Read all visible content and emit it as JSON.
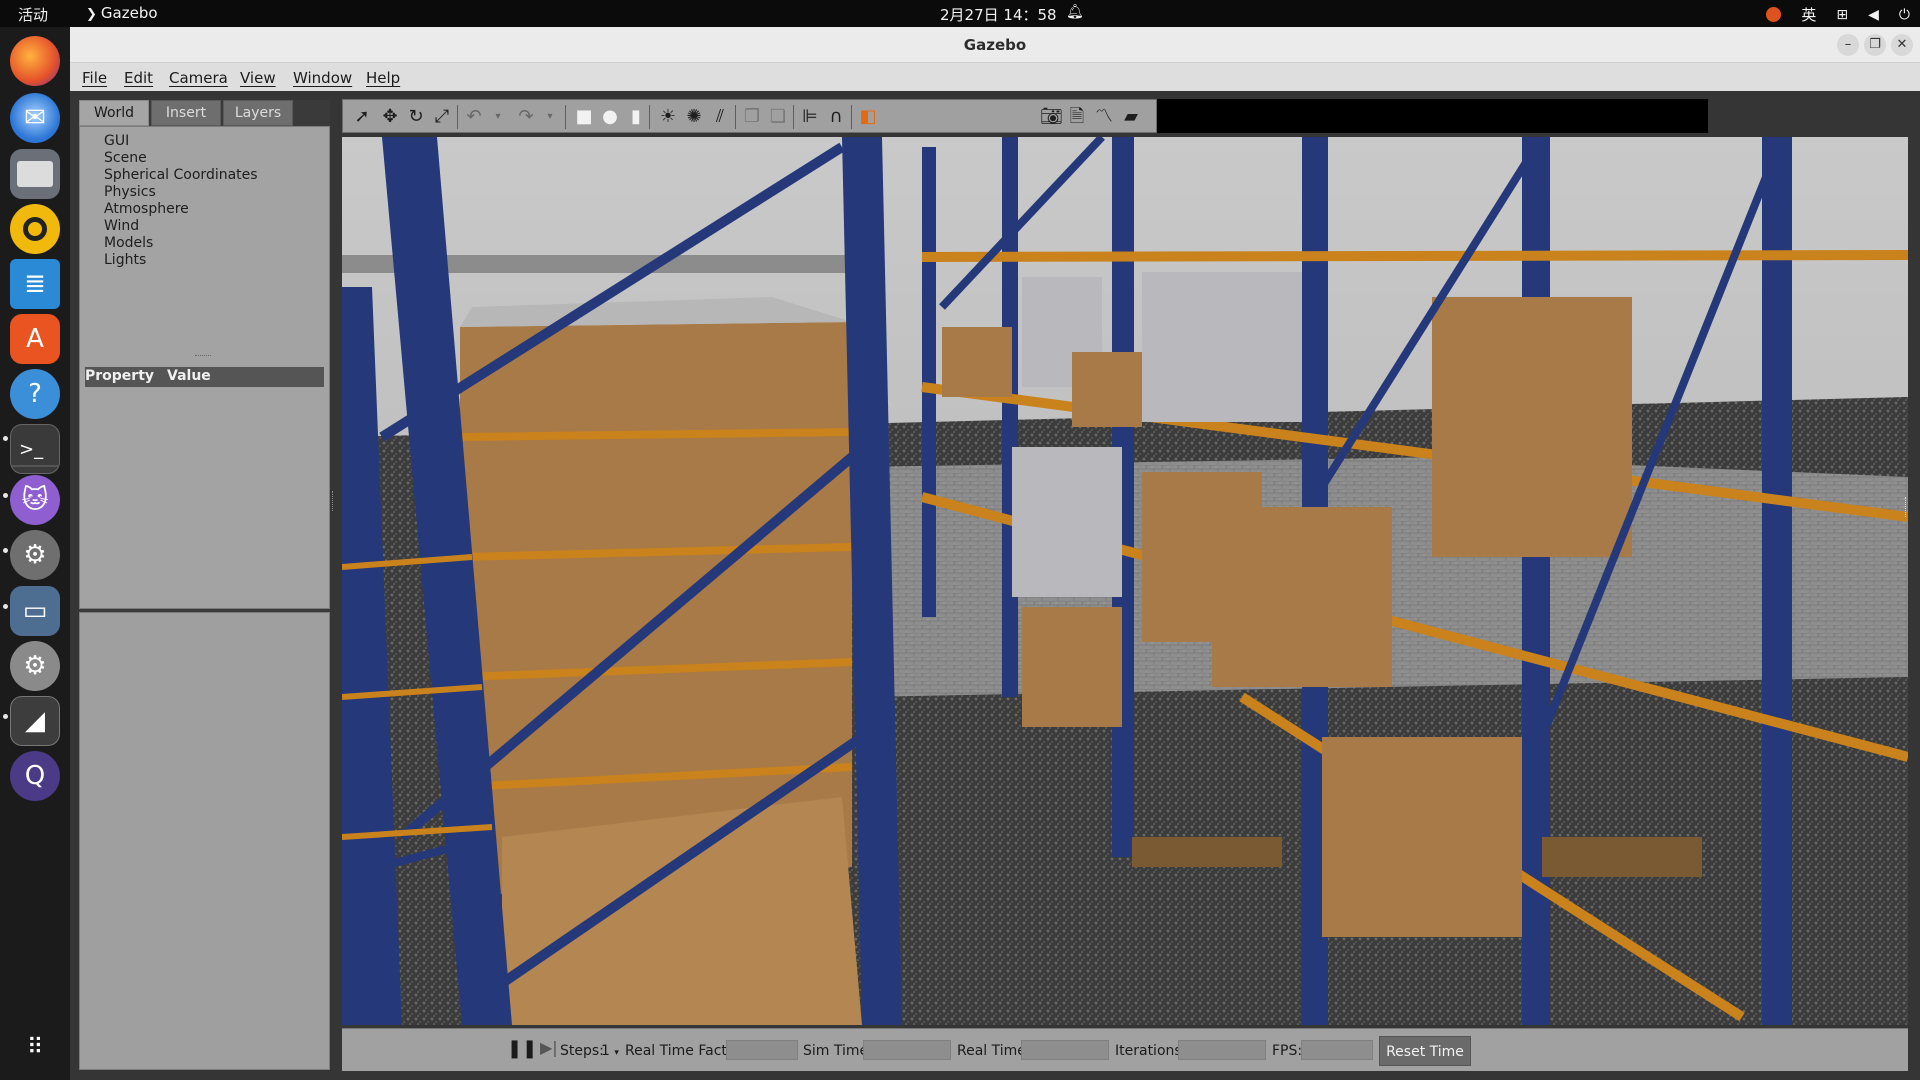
{
  "system_bar": {
    "activities": "活动",
    "app_name": "Gazebo",
    "clock": "2月27日 14：58",
    "input_method": "英"
  },
  "window": {
    "title": "Gazebo"
  },
  "menu": [
    "File",
    "Edit",
    "Camera",
    "View",
    "Window",
    "Help"
  ],
  "left_panel": {
    "tabs": [
      "World",
      "Insert",
      "Layers"
    ],
    "active_tab": "World",
    "tree": [
      "GUI",
      "Scene",
      "Spherical Coordinates",
      "Physics",
      "Atmosphere",
      "Wind",
      "Models",
      "Lights"
    ],
    "property_header": {
      "property": "Property",
      "value": "Value"
    }
  },
  "toolbar": {
    "tools": [
      "select-arrow-icon",
      "translate-icon",
      "rotate-icon",
      "scale-icon",
      "undo-icon",
      "undo-dropdown-icon",
      "redo-icon",
      "redo-dropdown-icon",
      "box-shape-icon",
      "sphere-shape-icon",
      "cylinder-shape-icon",
      "point-light-icon",
      "spot-light-icon",
      "directional-light-icon",
      "copy-icon",
      "paste-icon",
      "align-icon",
      "snap-icon",
      "view-angle-icon",
      "screenshot-icon",
      "log-icon",
      "plot-icon",
      "record-video-icon"
    ]
  },
  "bottom_bar": {
    "steps_label": "Steps:",
    "steps_value": "1",
    "real_time_factor_label": "Real Time Factor:",
    "sim_time_label": "Sim Time:",
    "real_time_label": "Real Time:",
    "iterations_label": "Iterations:",
    "fps_label": "FPS:",
    "reset_time_label": "Reset Time"
  },
  "colors": {
    "rack_blue": "#25397a",
    "rack_orange": "#c9821c",
    "cardboard": "#a87a47",
    "accent_orange": "#e0521d"
  }
}
